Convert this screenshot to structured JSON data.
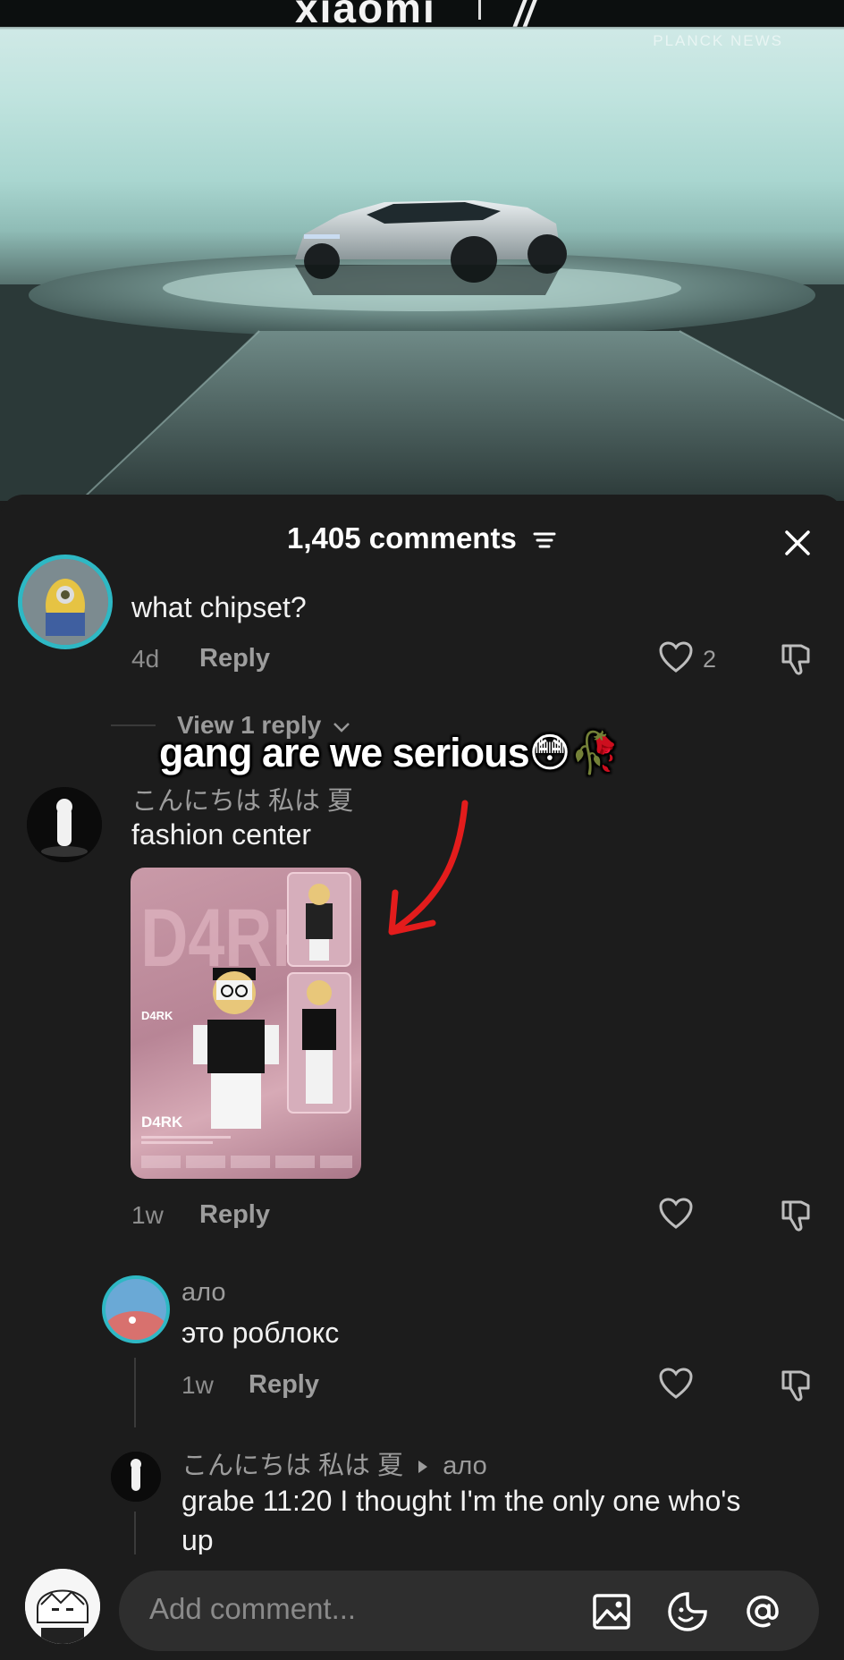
{
  "video": {
    "brand": "xiaomi",
    "watermark": "PLANCK NEWS"
  },
  "overlay": {
    "caption": "gang are we serious😳🥀"
  },
  "panel": {
    "title": "1,405 comments",
    "sort_icon": "sort-lines-icon",
    "close_icon": "close-icon"
  },
  "comments": [
    {
      "text": "what chipset?",
      "time": "4d",
      "reply_label": "Reply",
      "likes": "2",
      "view_replies": "View 1 reply"
    },
    {
      "username": "こんにちは 私は 夏",
      "text": "fashion center",
      "image_title": "D4RK",
      "image_label_1": "D4RK",
      "image_label_2": "D4RK",
      "time": "1w",
      "reply_label": "Reply"
    }
  ],
  "replies": [
    {
      "username": "ало",
      "text": "это роблокс",
      "time": "1w",
      "reply_label": "Reply"
    },
    {
      "username": "こんにちは 私は 夏",
      "reply_to": "ало",
      "text": "grabe 11:20 I thought I'm the only one who's",
      "text_line2": "up"
    }
  ],
  "footer": {
    "placeholder": "Add comment...",
    "icons": [
      "image-icon",
      "sticker-icon",
      "mention-icon"
    ]
  },
  "colors": {
    "panel_bg": "#1c1c1c",
    "text_primary": "#f2f2f2",
    "text_secondary": "#9c9c9c",
    "arrow_red": "#e31c1c",
    "input_bg": "#2e2e2e"
  }
}
